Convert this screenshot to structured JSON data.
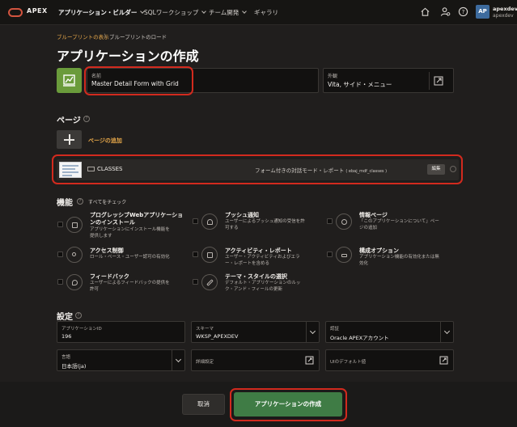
{
  "topbar": {
    "brand": "APEX",
    "nav": [
      {
        "label": "アプリケーション・ビルダー",
        "active": true
      },
      {
        "label": "SQLワークショップ",
        "active": false
      },
      {
        "label": "チーム開発",
        "active": false
      },
      {
        "label": "ギャラリ",
        "active": false
      }
    ],
    "icons": [
      "home-icon",
      "user-settings-icon",
      "help-icon"
    ],
    "avatar": "AP",
    "user_name": "apexdev",
    "user_workspace": "apexdev"
  },
  "breadcrumb": {
    "link": "ブループリントの表示",
    "separator": "\\",
    "current": "ブループリントのロード"
  },
  "page_title": "アプリケーションの作成",
  "name_field": {
    "label": "名前",
    "value": "Master Detail Form with Grid"
  },
  "appearance_field": {
    "label": "外観",
    "value": "Vita, サイド・メニュー"
  },
  "pages_section": {
    "heading": "ページ",
    "add_label": "ページの追加",
    "items": [
      {
        "name": "CLASSES",
        "type": "フォーム付きの対話モード・レポート",
        "table": "( ebaj_mdf_classes )",
        "edit_label": "編集"
      }
    ]
  },
  "features_section": {
    "heading": "機能",
    "check_all": "すべてをチェック",
    "items": [
      {
        "title_lines": [
          "プログレッシブWebアプリケーショ",
          "ンのインストール"
        ],
        "desc_lines": [
          "アプリケーションにインストール機能を",
          "提供します"
        ],
        "icon": "pwa-install-icon"
      },
      {
        "title_lines": [
          "プッシュ通知"
        ],
        "desc_lines": [
          "ユーザーによるプッシュ通知の受信を許",
          "可する"
        ],
        "icon": "bell-icon"
      },
      {
        "title_lines": [
          "情報ページ"
        ],
        "desc_lines": [
          "「このアプリケーションについて」ペー",
          "ジの追加"
        ],
        "icon": "info-icon"
      },
      {
        "title_lines": [
          "アクセス制御"
        ],
        "desc_lines": [
          "ロール・ベース・ユーザー認可の有効化"
        ],
        "icon": "key-icon"
      },
      {
        "title_lines": [
          "アクティビティ・レポート"
        ],
        "desc_lines": [
          "ユーザー・アクティビティおよびエラ",
          "ー・レポートを含める"
        ],
        "icon": "activity-report-icon"
      },
      {
        "title_lines": [
          "構成オプション"
        ],
        "desc_lines": [
          "アプリケーション機能の有効化または無",
          "効化"
        ],
        "icon": "config-sliders-icon"
      },
      {
        "title_lines": [
          "フィードバック"
        ],
        "desc_lines": [
          "ユーザーによるフィードバックの提供を",
          "許可"
        ],
        "icon": "feedback-icon"
      },
      {
        "title_lines": [
          "テーマ・スタイルの選択"
        ],
        "desc_lines": [
          "デフォルト・アプリケーションのルッ",
          "ク・アンド・フィールの更新"
        ],
        "icon": "brush-icon"
      }
    ]
  },
  "settings_section": {
    "heading": "設定",
    "fields": [
      {
        "label": "アプリケーションID",
        "value": "196",
        "kind": "text"
      },
      {
        "label": "スキーマ",
        "value": "WKSP_APEXDEV",
        "kind": "select"
      },
      {
        "label": "認証",
        "value": "Oracle APEXアカウント",
        "kind": "select"
      },
      {
        "label": "言語",
        "value": "日本語(ja)",
        "kind": "select"
      },
      {
        "label": "詳細設定",
        "value": "",
        "kind": "popup"
      },
      {
        "label": "UIのデフォルト値",
        "value": "",
        "kind": "popup"
      }
    ]
  },
  "buttons": {
    "cancel": "取消",
    "create": "アプリケーションの作成"
  },
  "colors": {
    "accent": "#e7a84a",
    "primary_button": "#3f7c45",
    "highlight": "#d22a1e",
    "app_icon": "#6a9b3b"
  }
}
